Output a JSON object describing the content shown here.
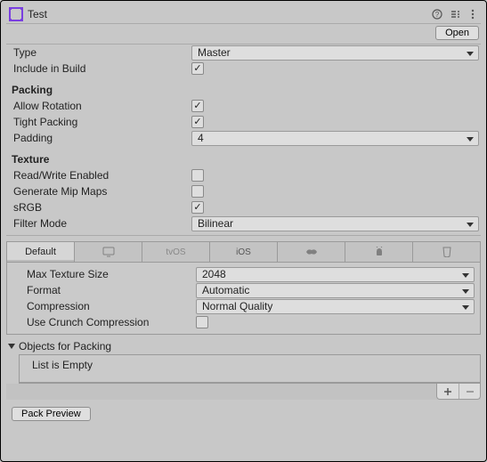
{
  "header": {
    "asset_name": "Test",
    "open_button": "Open"
  },
  "type": {
    "label": "Type",
    "value": "Master"
  },
  "include_in_build": {
    "label": "Include in Build",
    "checked": true
  },
  "packing": {
    "header": "Packing",
    "allow_rotation": {
      "label": "Allow Rotation",
      "checked": true
    },
    "tight_packing": {
      "label": "Tight Packing",
      "checked": true
    },
    "padding": {
      "label": "Padding",
      "value": "4"
    }
  },
  "texture": {
    "header": "Texture",
    "read_write": {
      "label": "Read/Write Enabled",
      "checked": false
    },
    "mip_maps": {
      "label": "Generate Mip Maps",
      "checked": false
    },
    "srgb": {
      "label": "sRGB",
      "checked": true
    },
    "filter_mode": {
      "label": "Filter Mode",
      "value": "Bilinear"
    }
  },
  "platform": {
    "tabs": {
      "default": "Default",
      "tvos": "tvOS",
      "ios": "iOS"
    },
    "max_texture_size": {
      "label": "Max Texture Size",
      "value": "2048"
    },
    "format": {
      "label": "Format",
      "value": "Automatic"
    },
    "compression": {
      "label": "Compression",
      "value": "Normal Quality"
    },
    "crunch": {
      "label": "Use Crunch Compression",
      "checked": false
    }
  },
  "objects": {
    "header": "Objects for Packing",
    "empty_text": "List is Empty"
  },
  "pack_preview": "Pack Preview"
}
